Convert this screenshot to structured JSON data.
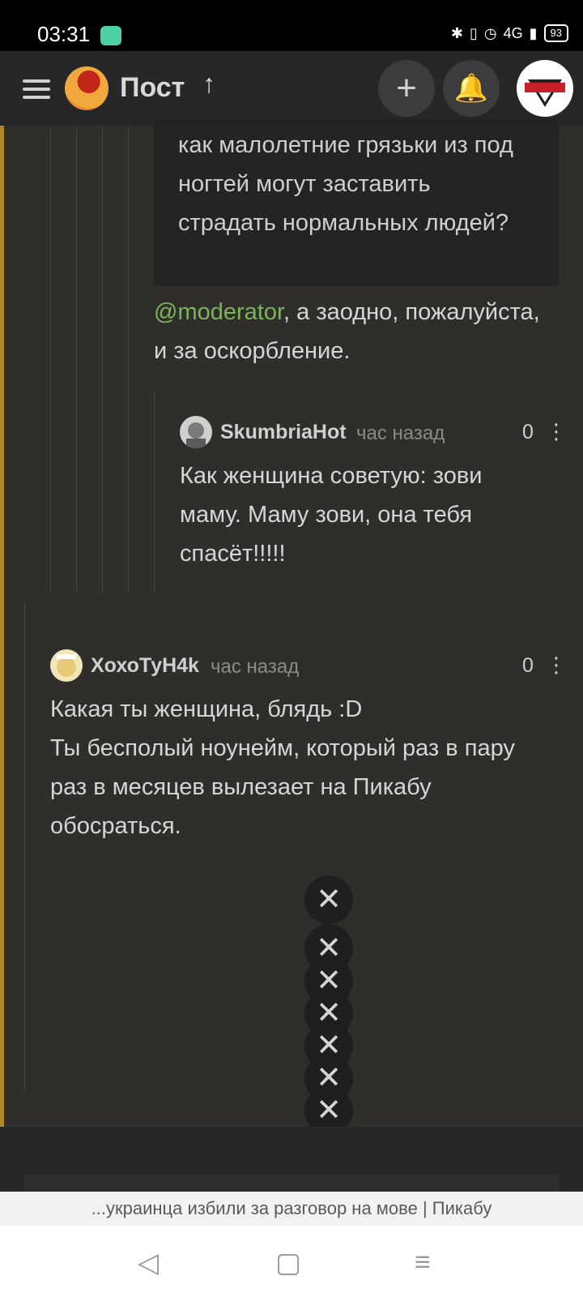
{
  "status_bar": {
    "time": "03:31",
    "battery": "93",
    "signal_label": "4G"
  },
  "top_bar": {
    "title": "Пост"
  },
  "quote": {
    "text": "как малолетние грязьки из под ногтей могут заставить страдать нормальных людей?"
  },
  "reply_comment": {
    "mention": "@moderator",
    "text_after": ", а заодно, пожалуйста, и за оскорбление."
  },
  "comments": [
    {
      "username": "SkumbriaHot",
      "time": "час назад",
      "score": "0",
      "text": "Как женщина советую: зови маму. Маму зови, она тебя спасёт!!!!!"
    },
    {
      "username": "XохоТуН4k",
      "time": "час назад",
      "score": "0",
      "text": "Какая ты женщина, блядь :D\nТы бесполый ноунейм, который раз в пару раз в месяцев вылезает на Пикабу обосраться."
    }
  ],
  "close_buttons": 7,
  "browser": {
    "url_text": "...украинца избили за разговор на мове | Пикабу"
  },
  "colors": {
    "background": "#2f2e2a",
    "topbar": "#252728",
    "thread_bar": "#b0892a",
    "mention": "#7bb55a"
  }
}
